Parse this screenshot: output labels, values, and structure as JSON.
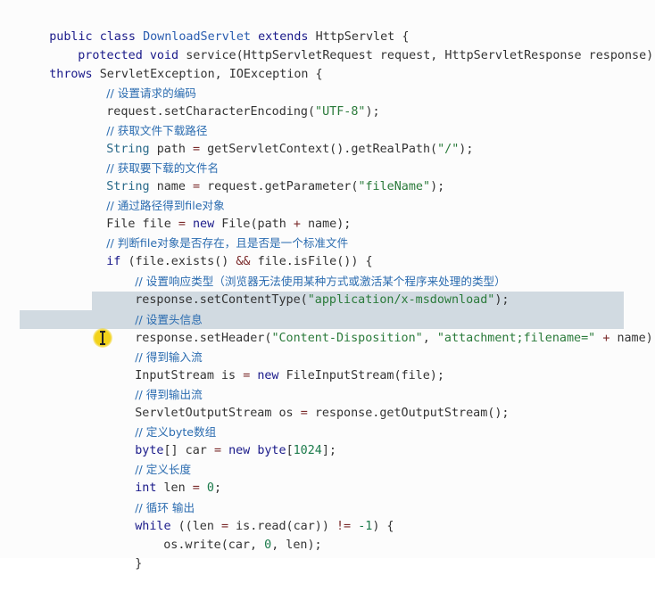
{
  "code": {
    "l1": [
      "public",
      "class",
      "DownloadServlet",
      "extends",
      "HttpServlet",
      "{"
    ],
    "l2": [
      "protected",
      "void",
      "service(HttpServletRequest request, HttpServletResponse response)"
    ],
    "l3": [
      "throws",
      "ServletException, IOException {"
    ],
    "l4": "// 设置请求的编码",
    "l5": [
      "request.setCharacterEncoding(",
      "\"UTF-8\"",
      ");"
    ],
    "l6": "// 获取文件下载路径",
    "l7": [
      "String",
      "path",
      "=",
      "getServletContext().getRealPath(",
      "\"/\"",
      ");"
    ],
    "l8": "// 获取要下载的文件名",
    "l9": [
      "String",
      "name",
      "=",
      "request.getParameter(",
      "\"fileName\"",
      ");"
    ],
    "l10": "// 通过路径得到file对象",
    "l11": [
      "File file",
      "=",
      "new",
      "File(path",
      "+",
      "name);"
    ],
    "l12": "// 判断file对象是否存在，且是否是一个标准文件",
    "l13": [
      "if",
      "(file.exists()",
      "&&",
      "file.isFile()) {"
    ],
    "l14": "// 设置响应类型（浏览器无法使用某种方式或激活某个程序来处理的类型）",
    "l15": [
      "response.setContentType(",
      "\"application/x-msdownload\"",
      ");"
    ],
    "l16": "// 设置头信息",
    "l17": [
      "response.setHeader(",
      "\"Content-Disposition\"",
      ",",
      "\"attachment;filename=\"",
      "+",
      "name);"
    ],
    "l18": "// 得到输入流",
    "l19": [
      "InputStream is",
      "=",
      "new",
      "FileInputStream(file);"
    ],
    "l20": "// 得到输出流",
    "l21": [
      "ServletOutputStream os",
      "=",
      "response.getOutputStream();"
    ],
    "l22": "// 定义byte数组",
    "l23": [
      "byte",
      "[] car",
      "=",
      "new",
      "byte",
      "[",
      "1024",
      "];"
    ],
    "l24": "// 定义长度",
    "l25": [
      "int",
      "len",
      "=",
      "0",
      ";"
    ],
    "l26": "// 循环 输出",
    "l27": [
      "while",
      "((len",
      "=",
      "is.read(car))",
      "!=",
      "-1",
      ") {"
    ],
    "l28": [
      "os.write(car,",
      "0",
      ", len);"
    ],
    "l29": "}"
  },
  "colors": {
    "keyword": "#1a1a8a",
    "string": "#2a7a3a",
    "comment": "#2b6cb0",
    "selection": "#c9d3dc",
    "cursor_highlight": "#f2d21a"
  },
  "cursor": {
    "icon": "text-cursor-icon"
  }
}
